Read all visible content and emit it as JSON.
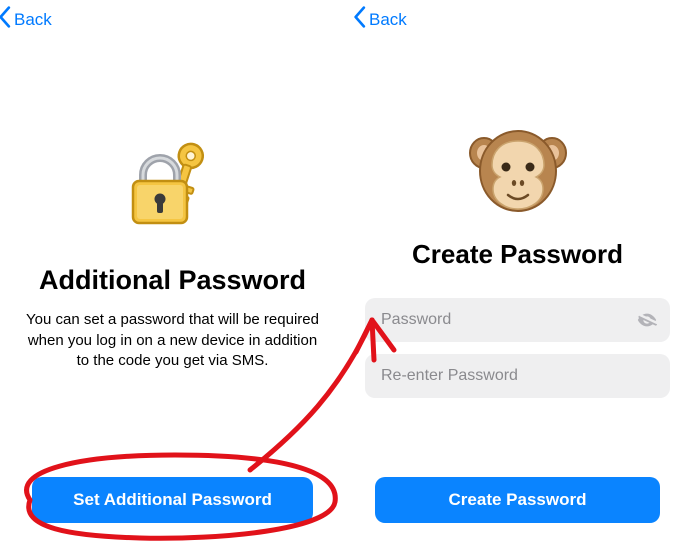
{
  "accent": "#007aff",
  "left": {
    "back_label": "Back",
    "title": "Additional Password",
    "description": "You can set a password that will be required when you log in on a new device in addition to the code you get via SMS.",
    "button_label": "Set Additional Password"
  },
  "right": {
    "back_label": "Back",
    "title": "Create Password",
    "password_placeholder": "Password",
    "password_value": "",
    "confirm_placeholder": "Re-enter Password",
    "confirm_value": "",
    "button_label": "Create Password"
  }
}
